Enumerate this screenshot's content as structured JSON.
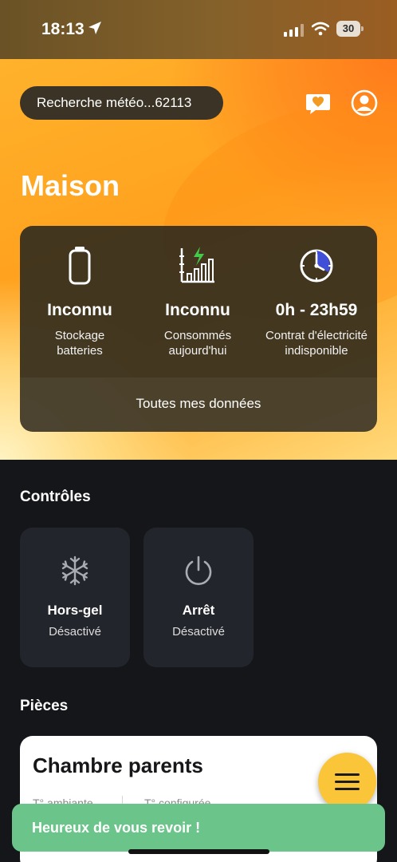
{
  "status_bar": {
    "time": "18:13",
    "battery": "30"
  },
  "header": {
    "search_label": "Recherche météo...62113",
    "title": "Maison"
  },
  "stats": [
    {
      "icon": "battery-icon",
      "value": "Inconnu",
      "label_line1": "Stockage",
      "label_line2": "batteries"
    },
    {
      "icon": "energy-chart-icon",
      "value": "Inconnu",
      "label_line1": "Consommés",
      "label_line2": "aujourd'hui"
    },
    {
      "icon": "clock-icon",
      "value": "0h - 23h59",
      "label_line1": "Contrat d'électricité",
      "label_line2": "indisponible"
    }
  ],
  "stats_footer": "Toutes mes données",
  "controls": {
    "title": "Contrôles",
    "items": [
      {
        "icon": "snowflake-icon",
        "name": "Hors-gel",
        "status": "Désactivé"
      },
      {
        "icon": "power-icon",
        "name": "Arrêt",
        "status": "Désactivé"
      }
    ]
  },
  "rooms": {
    "title": "Pièces",
    "items": [
      {
        "name": "Chambre parents",
        "sub1": "T° ambiante",
        "sub2": "T° configurée"
      }
    ]
  },
  "toast": "Heureux de vous revoir !",
  "colors": {
    "accent": "#fbc53a",
    "toast": "#6bc48a",
    "background": "#15161a"
  }
}
